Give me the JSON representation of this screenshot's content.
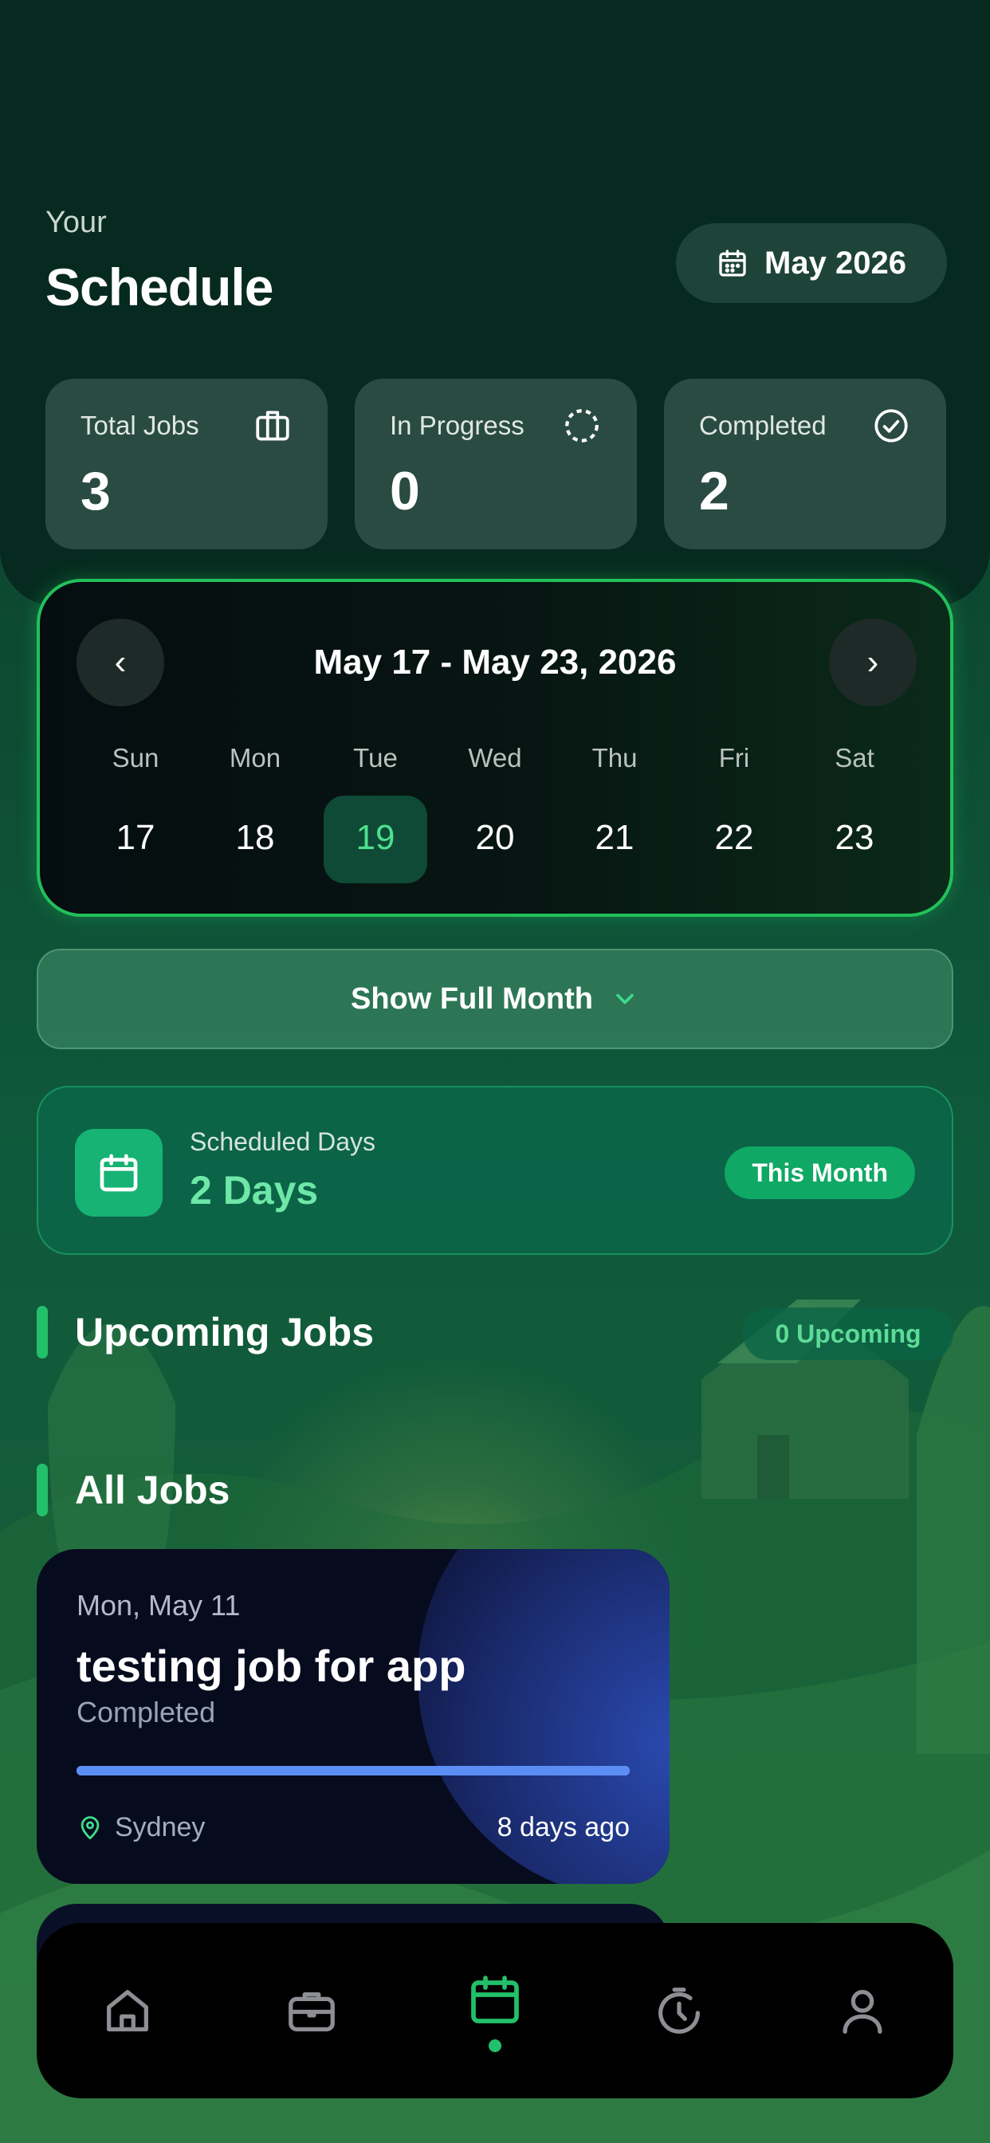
{
  "header": {
    "overline": "Your",
    "title": "Schedule",
    "month_selector": "May 2026"
  },
  "stats": [
    {
      "label": "Total Jobs",
      "value": "3",
      "icon": "briefcase-icon"
    },
    {
      "label": "In Progress",
      "value": "0",
      "icon": "dashed-circle-icon"
    },
    {
      "label": "Completed",
      "value": "2",
      "icon": "check-circle-icon"
    }
  ],
  "week": {
    "range": "May 17 - May 23, 2026",
    "prev": "‹",
    "next": "›",
    "days": [
      {
        "dow": "Sun",
        "num": "17"
      },
      {
        "dow": "Mon",
        "num": "18"
      },
      {
        "dow": "Tue",
        "num": "19"
      },
      {
        "dow": "Wed",
        "num": "20"
      },
      {
        "dow": "Thu",
        "num": "21"
      },
      {
        "dow": "Fri",
        "num": "22"
      },
      {
        "dow": "Sat",
        "num": "23"
      }
    ],
    "selected": "19"
  },
  "show_full_month": "Show Full Month",
  "scheduled": {
    "label": "Scheduled Days",
    "value": "2 Days",
    "badge": "This Month"
  },
  "upcoming": {
    "title": "Upcoming Jobs",
    "badge": "0 Upcoming"
  },
  "all_jobs": {
    "title": "All Jobs",
    "jobs": [
      {
        "date": "Mon, May 11",
        "title": "testing job for app",
        "status": "Completed",
        "progress": 1.0,
        "location": "Sydney",
        "ago": "8 days ago"
      }
    ]
  },
  "tabbar": {
    "items": [
      "home-icon",
      "briefcase-icon",
      "calendar-icon",
      "timer-icon",
      "profile-icon"
    ],
    "active": "calendar-icon"
  },
  "colors": {
    "accent": "#22c06a",
    "header_bg": "#062a1f",
    "job_card_bg": "#070b1e",
    "progress": "#5b8ef5"
  }
}
